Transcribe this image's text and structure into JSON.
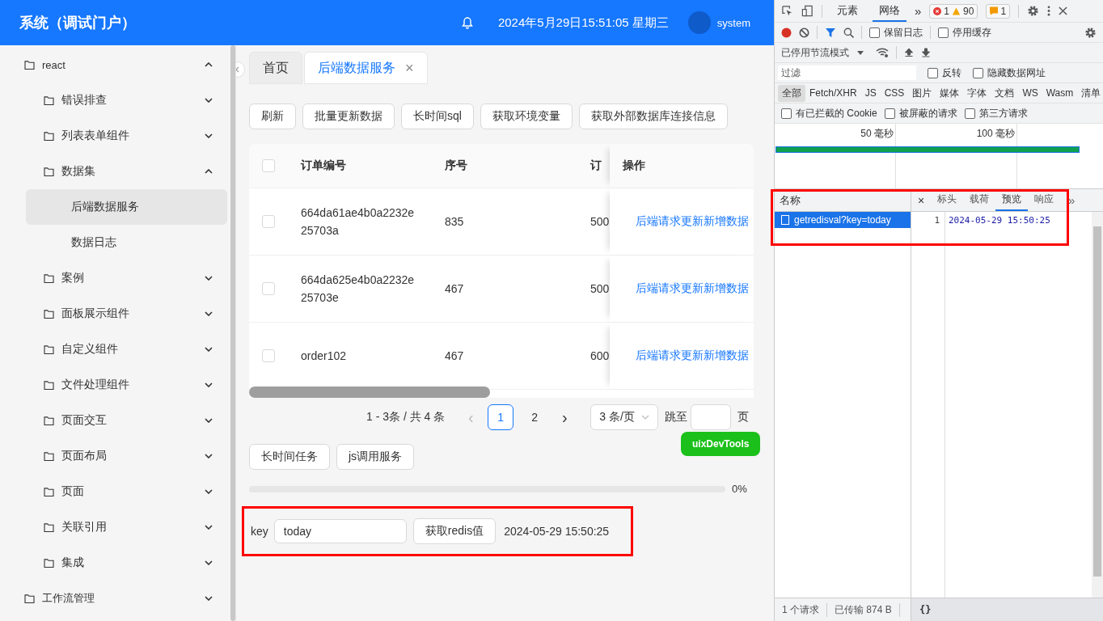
{
  "header": {
    "title": "系统（调试门户）",
    "datetime": "2024年5月29日15:51:05 星期三",
    "user": "system"
  },
  "sidebar": {
    "items": [
      {
        "label": "react",
        "expanded": true,
        "selected": false,
        "children": [
          {
            "label": "错误排查",
            "expanded": false,
            "selected": false
          },
          {
            "label": "列表表单组件",
            "expanded": false,
            "selected": false
          },
          {
            "label": "数据集",
            "expanded": true,
            "selected": false,
            "children": [
              {
                "label": "后端数据服务",
                "selected": true
              },
              {
                "label": "数据日志",
                "selected": false
              }
            ]
          },
          {
            "label": "案例",
            "expanded": false,
            "selected": false
          },
          {
            "label": "面板展示组件",
            "expanded": false,
            "selected": false
          },
          {
            "label": "自定义组件",
            "expanded": false,
            "selected": false
          },
          {
            "label": "文件处理组件",
            "expanded": false,
            "selected": false
          },
          {
            "label": "页面交互",
            "expanded": false,
            "selected": false
          },
          {
            "label": "页面布局",
            "expanded": false,
            "selected": false
          },
          {
            "label": "页面",
            "expanded": false,
            "selected": false
          },
          {
            "label": "关联引用",
            "expanded": false,
            "selected": false
          },
          {
            "label": "集成",
            "expanded": false,
            "selected": false
          }
        ]
      },
      {
        "label": "工作流管理",
        "expanded": false,
        "selected": false
      }
    ]
  },
  "tabs": [
    {
      "label": "首页",
      "selected": false,
      "closable": false
    },
    {
      "label": "后端数据服务",
      "selected": true,
      "closable": true
    }
  ],
  "close_glyph": "×",
  "toolbar": [
    "刷新",
    "批量更新数据",
    "长时间sql",
    "获取环境变量",
    "获取外部数据库连接信息"
  ],
  "table": {
    "header_checked": false,
    "columns": [
      "订单编号",
      "序号",
      "订"
    ],
    "action_column": "操作",
    "rows": [
      {
        "checked": false,
        "order_no": "664da61ae4b0a2232e25703a",
        "seq": "835",
        "column_3": "500",
        "action": "后端请求更新新增数据"
      },
      {
        "checked": false,
        "order_no": "664da625e4b0a2232e25703e",
        "seq": "467",
        "column_3": "500",
        "action": "后端请求更新新增数据"
      },
      {
        "checked": false,
        "order_no": "order102",
        "seq": "467",
        "column_3": "600",
        "action": "后端请求更新新增数据"
      }
    ]
  },
  "pagination": {
    "summary": "1 - 3条 / 共 4 条",
    "prev": "‹",
    "next": "›",
    "pages": [
      {
        "label": "1",
        "selected": true
      },
      {
        "label": "2",
        "selected": false
      }
    ],
    "page_size": "3 条/页",
    "jump_label": "跳至",
    "jump_suffix": "页"
  },
  "floating_badge": "uixDevTools",
  "actions": [
    "长时间任务",
    "js调用服务"
  ],
  "progress": {
    "level": 0,
    "reading": "0%"
  },
  "redis": {
    "highlighted": true,
    "label": "key",
    "value": "today",
    "button": "获取redis值",
    "result": "2024-05-29 15:50:25"
  },
  "devtools": {
    "tabs": [
      {
        "label": "元素",
        "selected": false
      },
      {
        "label": "网络",
        "selected": true
      }
    ],
    "more": "»",
    "errors": "1",
    "warnings": "90",
    "issues": "1",
    "recording": true,
    "preserve_log": {
      "label": "保留日志",
      "checked": false
    },
    "disable_cache": {
      "label": "停用缓存",
      "checked": false
    },
    "throttle": "已停用节流模式",
    "filter": {
      "placeholder": "过滤"
    },
    "invert": {
      "label": "反转",
      "checked": false
    },
    "hide_data_urls": {
      "label": "隐藏数据网址",
      "checked": false
    },
    "types": [
      {
        "label": "全部",
        "selected": true
      },
      {
        "label": "Fetch/XHR",
        "selected": false
      },
      {
        "label": "JS",
        "selected": false
      },
      {
        "label": "CSS",
        "selected": false
      },
      {
        "label": "图片",
        "selected": false
      },
      {
        "label": "媒体",
        "selected": false
      },
      {
        "label": "字体",
        "selected": false
      },
      {
        "label": "文档",
        "selected": false
      },
      {
        "label": "WS",
        "selected": false
      },
      {
        "label": "Wasm",
        "selected": false
      },
      {
        "label": "清单",
        "selected": false
      }
    ],
    "extra_filters": [
      {
        "label": "有已拦截的 Cookie",
        "checked": false
      },
      {
        "label": "被屏蔽的请求",
        "checked": false
      },
      {
        "label": "第三方请求",
        "checked": false
      }
    ],
    "overview_ticks": [
      "50 毫秒",
      "100 毫秒"
    ],
    "highlighted": true,
    "name_header": "名称",
    "requests": [
      {
        "name": "getredisval?key=today",
        "selected": true
      }
    ],
    "detail_close": "×",
    "detail_tabs": [
      {
        "label": "标头",
        "selected": false
      },
      {
        "label": "载荷",
        "selected": false
      },
      {
        "label": "预览",
        "selected": true
      },
      {
        "label": "响应",
        "selected": false
      }
    ],
    "preview": [
      {
        "line": "1",
        "text": "2024-05-29 15:50:25"
      }
    ],
    "status": [
      "1 个请求",
      "已传输 874 B"
    ],
    "format_button": "{}"
  }
}
